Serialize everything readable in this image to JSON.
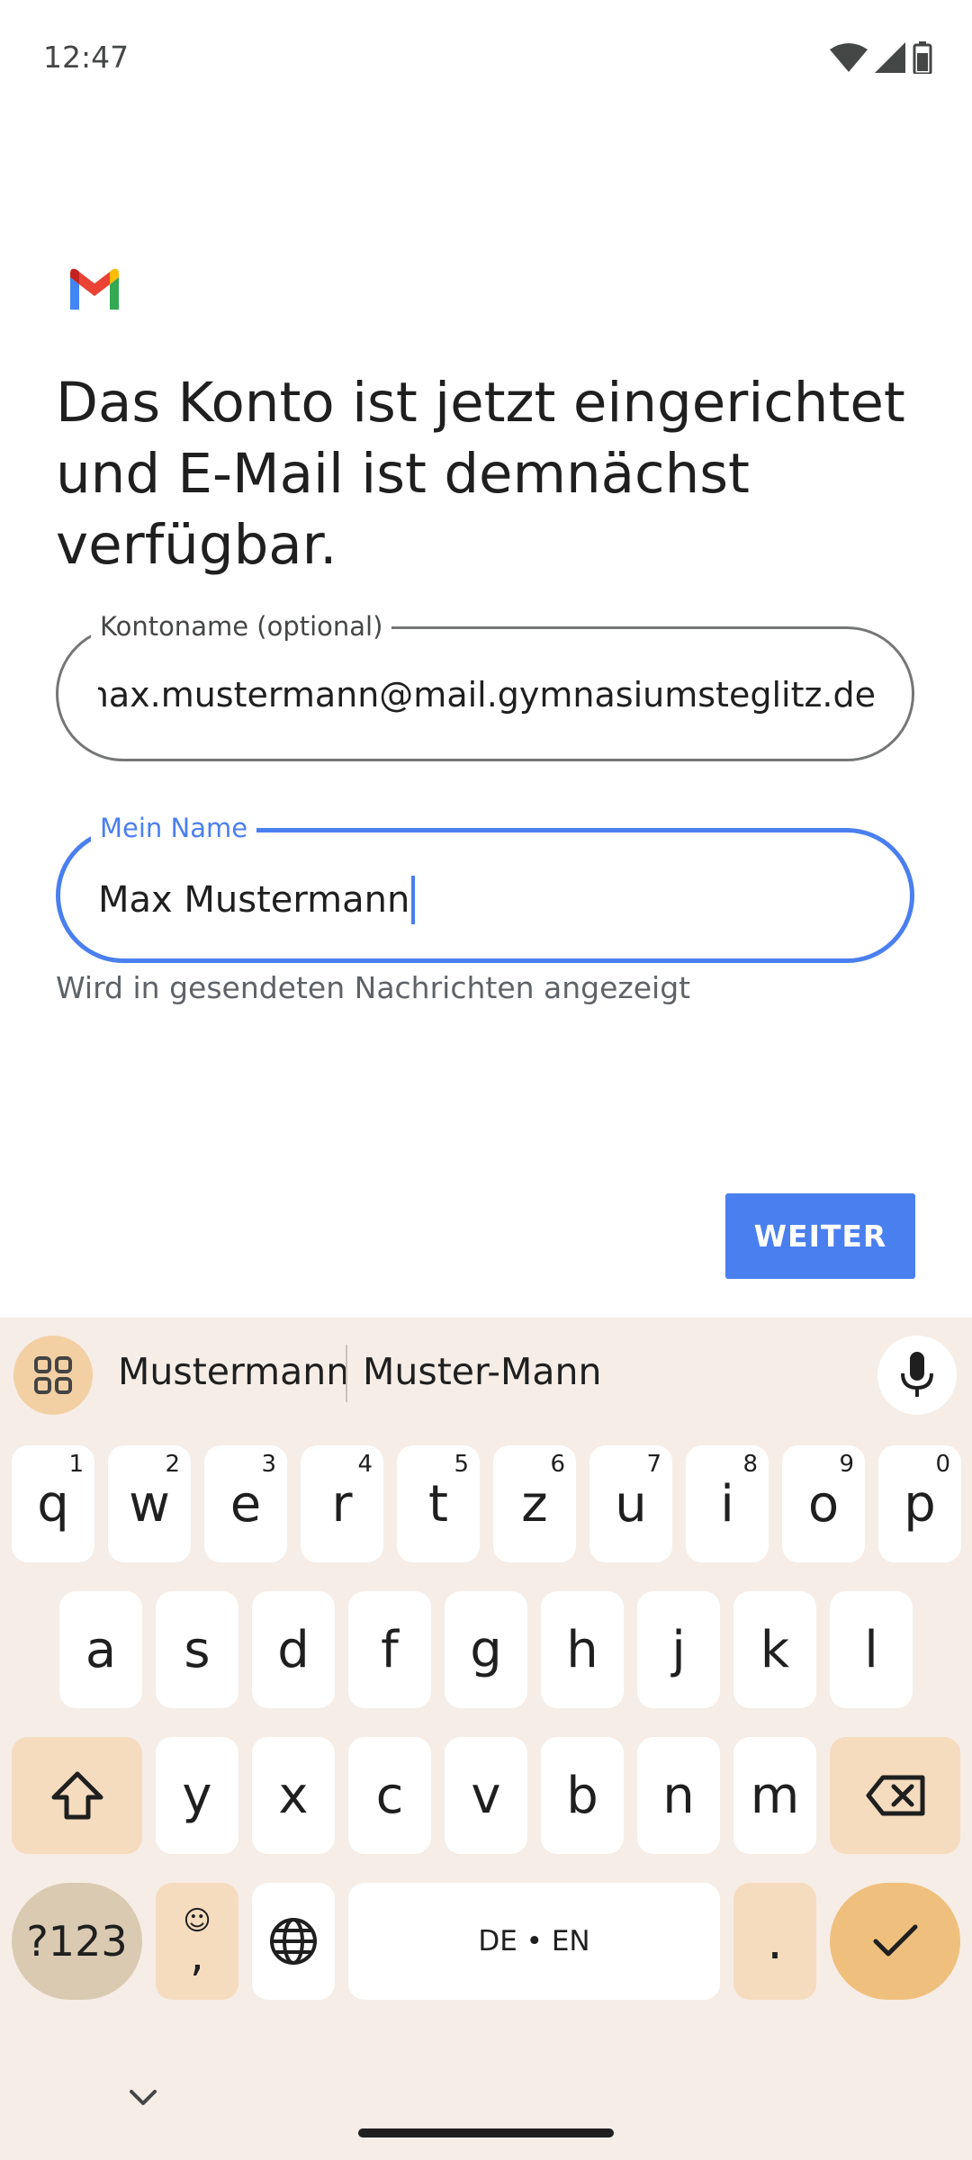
{
  "status_bar": {
    "time": "12:47"
  },
  "header": {
    "headline": "Das Konto ist jetzt eingerichtet und E-Mail ist demnächst verfügbar."
  },
  "account_name_field": {
    "label": "Kontoname (optional)",
    "value": "max.mustermann@mail.gymnasiumsteglitz.de"
  },
  "my_name_field": {
    "label": "Mein Name",
    "value": "Max Mustermann",
    "helper": "Wird in gesendeten Nachrichten angezeigt"
  },
  "next_button": {
    "label": "WEITER"
  },
  "keyboard": {
    "suggestions": [
      "Mustermann",
      "Muster-Mann"
    ],
    "row1": [
      {
        "key": "q",
        "hint": "1"
      },
      {
        "key": "w",
        "hint": "2"
      },
      {
        "key": "e",
        "hint": "3"
      },
      {
        "key": "r",
        "hint": "4"
      },
      {
        "key": "t",
        "hint": "5"
      },
      {
        "key": "z",
        "hint": "6"
      },
      {
        "key": "u",
        "hint": "7"
      },
      {
        "key": "i",
        "hint": "8"
      },
      {
        "key": "o",
        "hint": "9"
      },
      {
        "key": "p",
        "hint": "0"
      }
    ],
    "row2": [
      "a",
      "s",
      "d",
      "f",
      "g",
      "h",
      "j",
      "k",
      "l"
    ],
    "row3": [
      "y",
      "x",
      "c",
      "v",
      "b",
      "n",
      "m"
    ],
    "symbols_label": "?123",
    "comma_label": ",",
    "emoji_label": "☺",
    "space_label": "DE • EN",
    "period_label": "."
  },
  "colors": {
    "accent": "#4a7ff0",
    "keyboard_bg": "#f6ede7",
    "modifier_key": "#f6dcbf",
    "enter_key": "#efc07d"
  },
  "icons": [
    "wifi-icon",
    "signal-icon",
    "battery-icon",
    "gmail-logo",
    "apps-grid-icon",
    "mic-icon",
    "shift-icon",
    "backspace-icon",
    "globe-icon",
    "check-icon",
    "chevron-down-icon"
  ]
}
